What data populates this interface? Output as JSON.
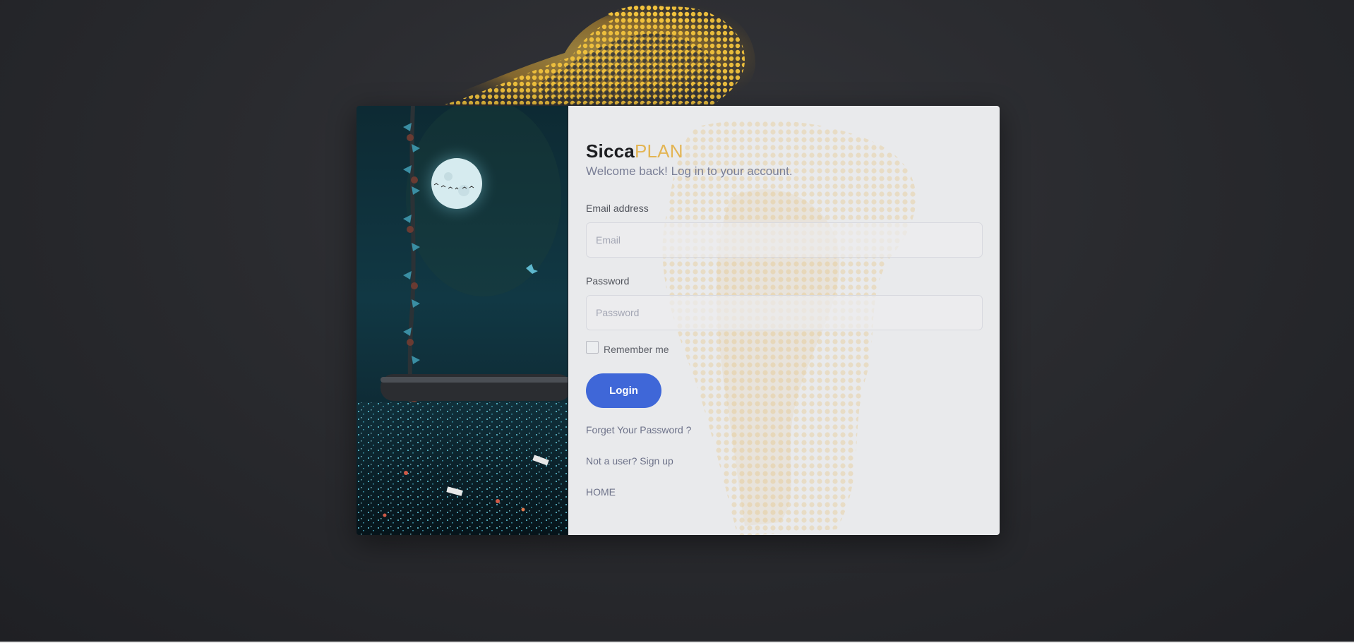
{
  "brand": {
    "name_main": "Sicca",
    "name_accent": "PLAN"
  },
  "subtitle": "Welcome back! Log in to your account.",
  "form": {
    "email_label": "Email address",
    "email_placeholder": "Email",
    "email_value": "",
    "password_label": "Password",
    "password_placeholder": "Password",
    "password_value": "",
    "remember_label": "Remember me",
    "remember_checked": false,
    "login_label": "Login"
  },
  "links": {
    "forgot": "Forget Your Password ?",
    "signup": "Not a user? Sign up",
    "home": "HOME"
  },
  "colors": {
    "accent": "#e3b554",
    "primary_button": "#3f67d8",
    "background": "#2a2b2f",
    "form_panel": "#e9eaec"
  },
  "image": {
    "semantic": "night-moon-swing-city-illustration"
  }
}
